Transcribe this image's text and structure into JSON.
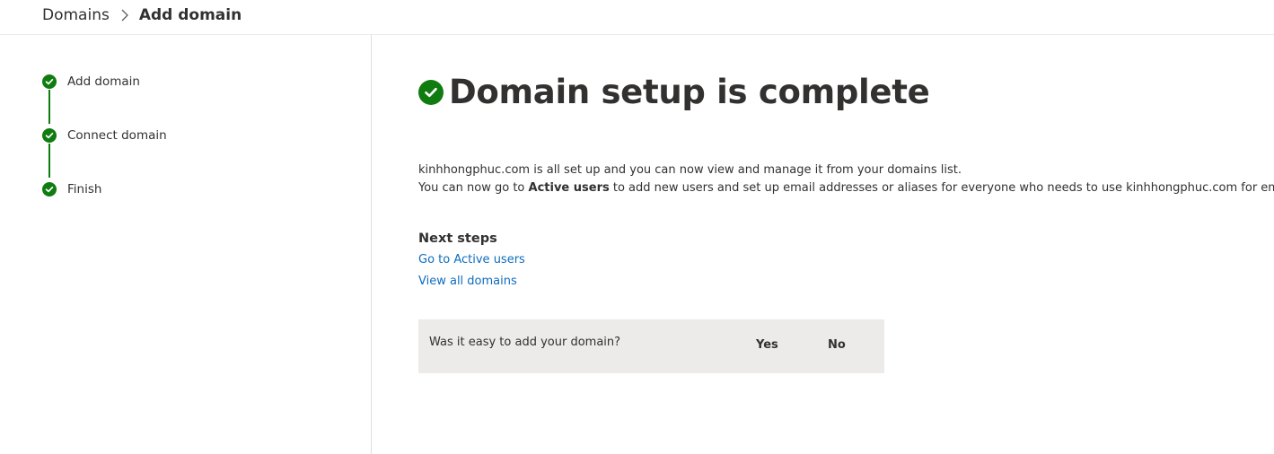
{
  "breadcrumb": {
    "parent": "Domains",
    "current": "Add domain"
  },
  "steps": [
    {
      "label": "Add domain",
      "status": "complete"
    },
    {
      "label": "Connect domain",
      "status": "complete"
    },
    {
      "label": "Finish",
      "status": "complete"
    }
  ],
  "main": {
    "title": "Domain setup is complete",
    "description_line1": "kinhhongphuc.com is all set up and you can now view and manage it from your domains list.",
    "description_line2_prefix": "You can now go to ",
    "description_line2_bold": "Active users",
    "description_line2_suffix": " to add new users and set up email addresses or aliases for everyone who needs to use kinhhongphuc.com for email.",
    "next_steps_title": "Next steps",
    "links": {
      "active_users": "Go to Active users",
      "all_domains": "View all domains"
    },
    "feedback": {
      "question": "Was it easy to add your domain?",
      "yes": "Yes",
      "no": "No"
    }
  },
  "icons": {
    "breadcrumb_separator": "chevron-right-icon",
    "step_complete": "check-circle-icon",
    "title_status": "check-circle-icon"
  },
  "colors": {
    "success": "#107c10",
    "link": "#0f6cbd",
    "text": "#323130",
    "feedback_bg": "#edebe9"
  }
}
